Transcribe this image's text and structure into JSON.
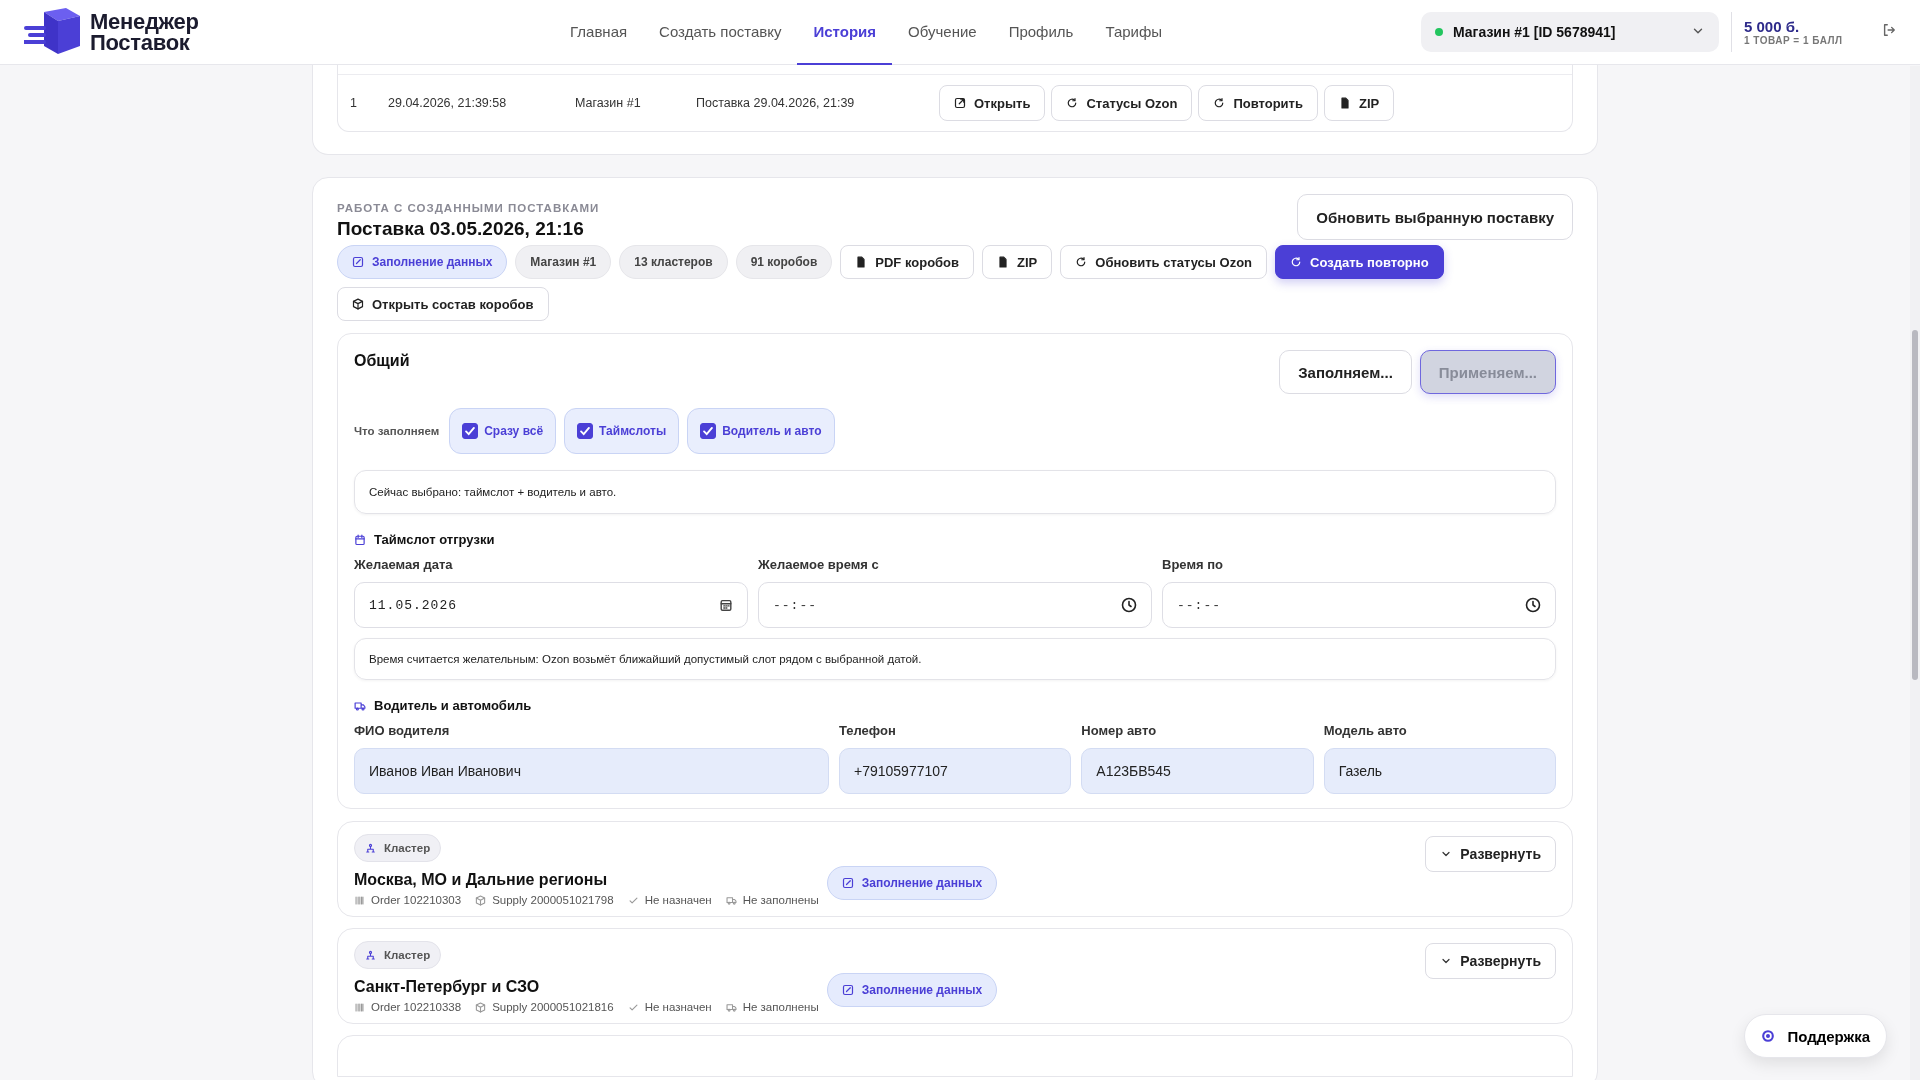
{
  "header": {
    "logo": {
      "line1": "Менеджер",
      "line2": "Поставок"
    },
    "nav": [
      {
        "label": "Главная",
        "selected": false
      },
      {
        "label": "Создать поставку",
        "selected": false
      },
      {
        "label": "История",
        "selected": true
      },
      {
        "label": "Обучение",
        "selected": false
      },
      {
        "label": "Профиль",
        "selected": false
      },
      {
        "label": "Тарифы",
        "selected": false
      }
    ],
    "store": {
      "label": "Магазин #1 [ID 5678941]",
      "online": true
    },
    "balance": {
      "amount": "5 000 б.",
      "rate": "1 ТОВАР = 1 БАЛЛ"
    }
  },
  "history_table": {
    "rows": [
      {
        "number": "1",
        "datetime": "29.04.2026, 21:39:58",
        "store": "Магазин #1",
        "name": "Поставка 29.04.2026, 21:39",
        "actions": [
          {
            "kind": "open",
            "label": "Открыть"
          },
          {
            "kind": "refresh",
            "label": "Статусы Ozon"
          },
          {
            "kind": "refresh",
            "label": "Повторить"
          },
          {
            "kind": "file",
            "label": "ZIP"
          }
        ]
      }
    ]
  },
  "supply_work": {
    "eyebrow": "РАБОТА С СОЗДАННЫМИ ПОСТАВКАМИ",
    "title": "Поставка 03.05.2026, 21:16",
    "update_button": "Обновить выбранную поставку",
    "chips": [
      {
        "kind": "status",
        "label": "Заполнение данных"
      },
      {
        "kind": "tag",
        "label": "Магазин #1"
      },
      {
        "kind": "tag",
        "label": "13 кластеров"
      },
      {
        "kind": "tag",
        "label": "91 коробов"
      },
      {
        "kind": "file",
        "label": "PDF коробов"
      },
      {
        "kind": "file",
        "label": "ZIP"
      },
      {
        "kind": "refresh",
        "label": "Обновить статусы Ozon"
      },
      {
        "kind": "primary",
        "label": "Создать повторно"
      },
      {
        "kind": "box",
        "label": "Открыть состав коробов"
      }
    ],
    "general": {
      "title": "Общий",
      "fill_button": "Заполняем...",
      "apply_button": {
        "label": "Применяем...",
        "disabled": true
      },
      "fill_label": "Что заполняем",
      "options": [
        {
          "label": "Сразу всё",
          "checked": true
        },
        {
          "label": "Таймслоты",
          "checked": true
        },
        {
          "label": "Водитель и авто",
          "checked": true
        }
      ],
      "selection_info": "Сейчас выбрано: таймслот + водитель и авто.",
      "timeslot": {
        "title": "Таймслот отгрузки",
        "fields": [
          {
            "kind": "date",
            "label": "Желаемая дата",
            "value": "11.05.2026"
          },
          {
            "kind": "time",
            "label": "Желаемое время с",
            "placeholder": "--:--"
          },
          {
            "kind": "time",
            "label": "Время по",
            "placeholder": "--:--"
          }
        ],
        "hint": "Время считается желательным: Ozon возьмёт ближайший допустимый слот рядом с выбранной датой."
      },
      "driver": {
        "title": "Водитель и автомобиль",
        "fields": [
          {
            "label": "ФИО водителя",
            "value": "Иванов Иван Иванович"
          },
          {
            "label": "Телефон",
            "value": "+79105977107"
          },
          {
            "label": "Номер авто",
            "value": "А123БВ545"
          },
          {
            "label": "Модель авто",
            "value": "Газель"
          }
        ]
      }
    },
    "clusters": [
      {
        "tag": "Кластер",
        "name": "Москва, МО и Дальние регионы",
        "order": "Order 102210303",
        "supply": "Supply 2000051021798",
        "assignment": "Не назначен",
        "vehicle": "Не заполнены",
        "status": "Заполнение данных",
        "expand_button": "Развернуть"
      },
      {
        "tag": "Кластер",
        "name": "Санкт-Петербург и СЗО",
        "order": "Order 102210338",
        "supply": "Supply 2000051021816",
        "assignment": "Не назначен",
        "vehicle": "Не заполнены",
        "status": "Заполнение данных",
        "expand_button": "Развернуть"
      }
    ]
  },
  "support_button": "Поддержка"
}
